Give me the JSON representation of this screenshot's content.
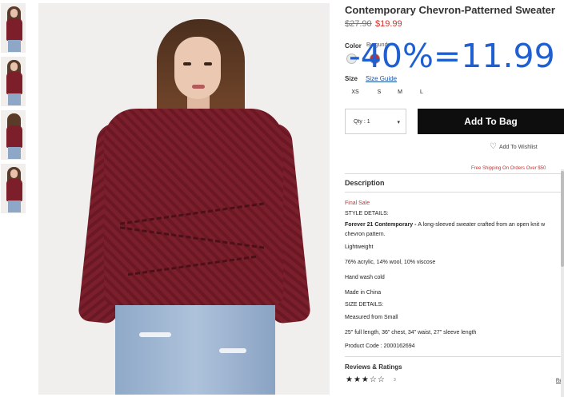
{
  "product": {
    "title": "Contemporary Chevron-Patterned Sweater",
    "price_original": "$27.90",
    "price_sale": "$19.99",
    "promo_overlay": "-40%=11.99"
  },
  "color": {
    "label": "Color",
    "selected": "Burgundy",
    "swatches": [
      "#e9e9e9",
      "#c0312d"
    ]
  },
  "size": {
    "label": "Size",
    "guide_label": "Size Guide",
    "options": [
      "XS",
      "S",
      "M",
      "L"
    ]
  },
  "purchase": {
    "qty_label": "Qty : 1",
    "qty_caret": "▾",
    "add_to_bag": "Add To Bag",
    "wishlist": "Add To Wishlist",
    "shipping_note": "Free Shipping On Orders Over $50"
  },
  "description": {
    "heading": "Description",
    "final_sale": "Final Sale",
    "style_details_label": "STYLE DETAILS:",
    "brand": "Forever 21 Contemporary - ",
    "summary_line1": "A long-sleeved sweater crafted from an open knit w",
    "summary_line2": "chevron pattern.",
    "lightweight": "Lightweight",
    "fabric": "76% acrylic, 14% wool, 10% viscose",
    "care": "Hand wash cold",
    "origin": "Made in China",
    "size_details_label": "SIZE DETAILS:",
    "measured": "Measured from Small",
    "measurements": "25\" full length, 36\" chest, 34\" waist, 27\" sleeve length",
    "product_code": "Product Code : 2000162694"
  },
  "reviews": {
    "heading": "Reviews & Ratings",
    "stars": "★★★☆☆",
    "rating": 3,
    "count": "3",
    "link": "Re"
  },
  "colors": {
    "accent_red": "#d0312d",
    "button_black": "#0e0e0e",
    "promo_blue": "#1f5fd1",
    "sweater": "#7a1f2b"
  }
}
